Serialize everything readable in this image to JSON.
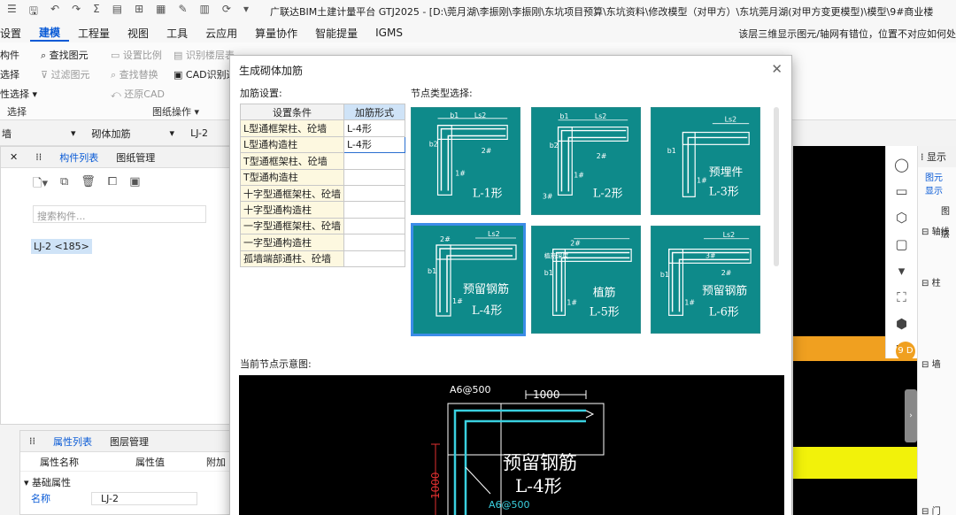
{
  "titlebar": {
    "title": "广联达BIM土建计量平台 GTJ2025 - [D:\\莞月湖\\李振刚\\李振刚\\东坑项目预算\\东坑资料\\修改模型（对甲方）\\东坑莞月湖(对甲方变更模型)\\模型\\9#商业楼"
  },
  "ribbon_tabs": [
    "设置",
    "建模",
    "工程量",
    "视图",
    "工具",
    "云应用",
    "算量协作",
    "智能提量",
    "IGMS"
  ],
  "ribbon_notice": "该层三维显示图元/轴网有错位，位置不对应如何处",
  "ribbon": {
    "left": [
      "构件",
      "选择",
      "性选择 ▾"
    ],
    "find_elem": "查找图元",
    "filter_elem": "过滤图元",
    "set_ratio": "设置比例",
    "identify_layer": "识别楼层表",
    "find_replace": "查找替换",
    "cad_identify": "CAD识别选",
    "restore_cad": "还原CAD",
    "group_select": "选择",
    "group_drawing": "图纸操作 ▾"
  },
  "selector": {
    "layer": "墙",
    "type": "砌体加筋",
    "elem": "LJ-2"
  },
  "comp_panel": {
    "tabs": [
      "构件列表",
      "图纸管理"
    ],
    "search_placeholder": "搜索构件...",
    "item": "LJ-2 <185>"
  },
  "prop_panel": {
    "tabs": [
      "属性列表",
      "图层管理"
    ],
    "cols": [
      "属性名称",
      "属性值",
      "附加"
    ],
    "group": "基础属性",
    "row_name": "名称",
    "row_value": "LJ-2"
  },
  "dialog": {
    "title": "生成砌体加筋",
    "settings_label": "加筋设置:",
    "node_label": "节点类型选择:",
    "preview_label": "当前节点示意图:",
    "table_headers": [
      "设置条件",
      "加筋形式"
    ],
    "rows": [
      {
        "cond": "L型通框架柱、砼墙",
        "form": "L-4形"
      },
      {
        "cond": "L型通构造柱",
        "form": "L-4形"
      },
      {
        "cond": "T型通框架柱、砼墙",
        "form": ""
      },
      {
        "cond": "T型通构造柱",
        "form": ""
      },
      {
        "cond": "十字型通框架柱、砼墙",
        "form": ""
      },
      {
        "cond": "十字型通构造柱",
        "form": ""
      },
      {
        "cond": "一字型通框架柱、砼墙",
        "form": ""
      },
      {
        "cond": "一字型通构造柱",
        "form": ""
      },
      {
        "cond": "孤墙端部通柱、砼墙",
        "form": ""
      }
    ],
    "nodes": [
      {
        "label": "L-1形",
        "sub": ""
      },
      {
        "label": "L-2形",
        "sub": ""
      },
      {
        "label": "L-3形",
        "sub": "预埋件"
      },
      {
        "label": "L-4形",
        "sub": "预留钢筋"
      },
      {
        "label": "L-5形",
        "sub": "植筋"
      },
      {
        "label": "L-6形",
        "sub": "预留钢筋"
      }
    ],
    "node_marks": {
      "b1": "b1",
      "ls2": "Ls2",
      "b2": "b2",
      "bar1": "1#",
      "bar2": "2#",
      "bar3": "3#",
      "anchor": "植筋深度"
    },
    "preview": {
      "top_rebar": "A6@500",
      "len_h": "1000",
      "len_v": "1000",
      "bottom_rebar": "A6@500",
      "sub": "预留钢筋",
      "label": "L-4形"
    }
  },
  "right_panel": {
    "header": "显示",
    "sub": "图元显示",
    "groups": [
      "图层",
      "轴线",
      "柱",
      "墙",
      "门"
    ]
  },
  "cad_marker": "9 D",
  "colors": {
    "node_bg": "#0e8a8a",
    "accent": "#0a5bd6",
    "selected_border": "#3c8ce8",
    "cad_bg": "#000000"
  }
}
